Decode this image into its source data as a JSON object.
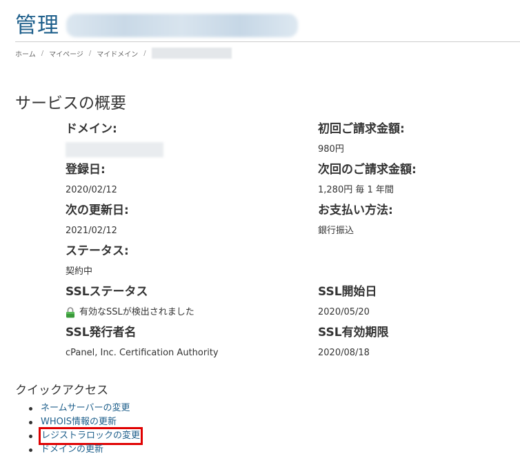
{
  "header": {
    "title": "管理"
  },
  "breadcrumb": {
    "items": [
      "ホーム",
      "マイページ",
      "マイドメイン"
    ],
    "separator": "/"
  },
  "overview": {
    "title": "サービスの概要",
    "left": [
      {
        "label": "ドメイン:",
        "value": ""
      },
      {
        "label": "登録日:",
        "value": "2020/02/12"
      },
      {
        "label": "次の更新日:",
        "value": "2021/02/12"
      },
      {
        "label": "ステータス:",
        "value": "契約中"
      },
      {
        "label": "SSLステータス",
        "value": "有効なSSLが検出されました"
      },
      {
        "label": "SSL発行者名",
        "value": "cPanel, Inc. Certification Authority"
      }
    ],
    "right": [
      {
        "label": "初回ご請求金額:",
        "value": "980円"
      },
      {
        "label": "次回のご請求金額:",
        "value": "1,280円 毎 1 年間"
      },
      {
        "label": "お支払い方法:",
        "value": "銀行振込"
      },
      {
        "label": "SSL開始日",
        "value": "2020/05/20"
      },
      {
        "label": "SSL有効期限",
        "value": "2020/08/18"
      }
    ]
  },
  "quick_access": {
    "title": "クイックアクセス",
    "links": [
      "ネームサーバーの変更",
      "WHOIS情報の更新",
      "レジストラロックの変更",
      "ドメインの更新"
    ]
  },
  "colors": {
    "title_blue": "#1e5f8b",
    "link_blue": "#1e5f8b",
    "highlight_red": "#e00000",
    "lock_green": "#3a9a3a"
  }
}
